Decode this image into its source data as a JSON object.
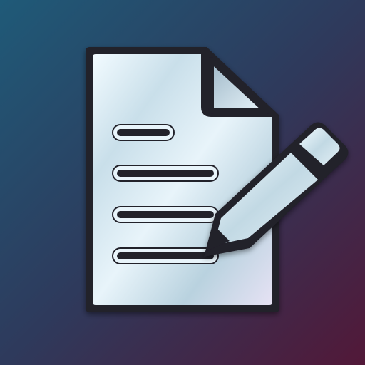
{
  "icon": {
    "name": "document-edit-app-icon",
    "glyph": "document-with-pencil",
    "text_lines_on_document": 4
  },
  "colors": {
    "background_top_left": "#1f5a78",
    "background_middle": "#2e3a5c",
    "background_bottom_right": "#521838",
    "document_paper_light": "#e8f4fa",
    "document_paper_shadow": "#9fb8c8",
    "outline_dark": "#22202a",
    "pencil_body": "#d6e9f1"
  }
}
